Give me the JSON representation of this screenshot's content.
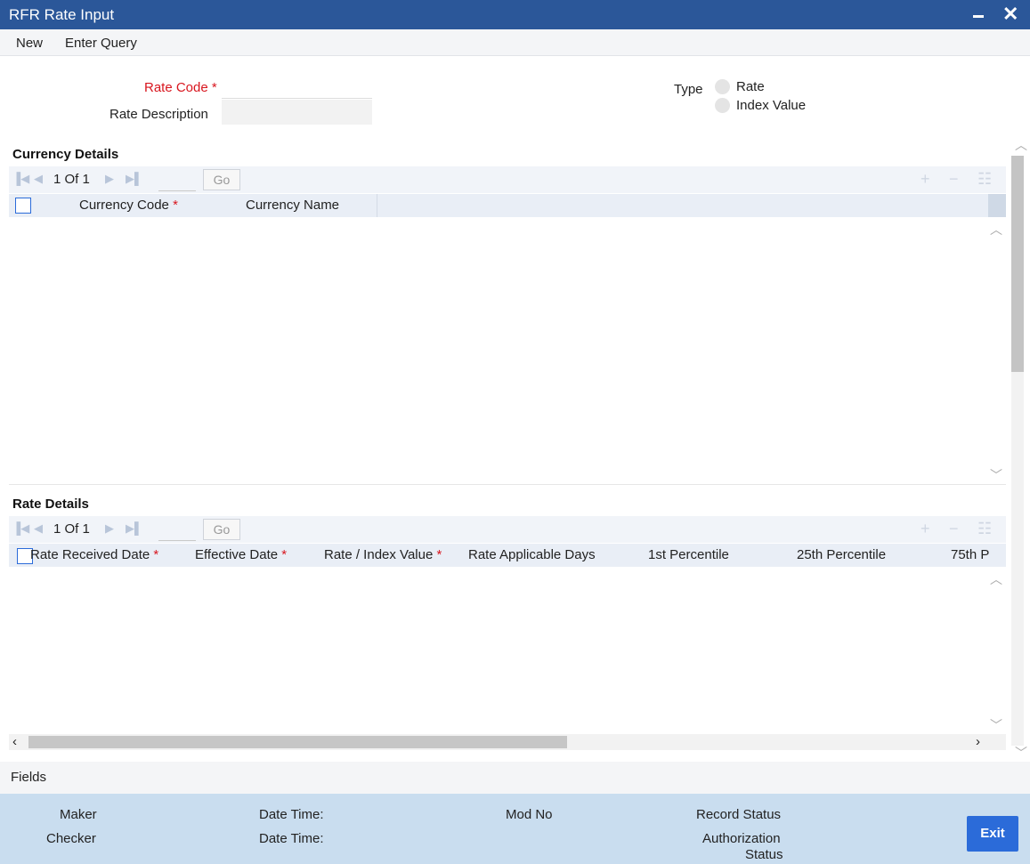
{
  "window": {
    "title": "RFR Rate Input"
  },
  "menu": {
    "new": "New",
    "enter_query": "Enter Query"
  },
  "form": {
    "rate_code_label": "Rate Code",
    "required_mark": "*",
    "rate_code_value": "",
    "rate_description_label": "Rate Description",
    "rate_description_value": "",
    "type_label": "Type",
    "type_options": [
      "Rate",
      "Index Value"
    ]
  },
  "currency_details": {
    "title": "Currency Details",
    "pager_text": "1 Of 1",
    "go_label": "Go",
    "columns": [
      "Currency Code",
      "Currency Name"
    ],
    "required_mark": "*",
    "rows": []
  },
  "rate_details": {
    "title": "Rate Details",
    "pager_text": "1 Of 1",
    "go_label": "Go",
    "columns": [
      "Rate Received Date",
      "Effective Date",
      "Rate / Index Value",
      "Rate Applicable Days",
      "1st Percentile",
      "25th Percentile",
      "75th P"
    ],
    "required_mark": "*",
    "rows": []
  },
  "fields_link": "Fields",
  "footer": {
    "maker": "Maker",
    "checker": "Checker",
    "date_time_1": "Date Time:",
    "date_time_2": "Date Time:",
    "mod_no": "Mod No",
    "record_status": "Record Status",
    "authorization_status_line1": "Authorization",
    "authorization_status_line2": "Status",
    "exit": "Exit"
  },
  "icons": {
    "first": "first-page-icon",
    "prev": "prev-page-icon",
    "next": "next-page-icon",
    "last": "last-page-icon",
    "add": "add-row-icon",
    "delete": "delete-row-icon",
    "view": "single-view-icon"
  },
  "colors": {
    "titlebar": "#2b5799",
    "required": "#d8161f",
    "footer": "#c9ddef",
    "exit_button": "#2b6bd9"
  }
}
